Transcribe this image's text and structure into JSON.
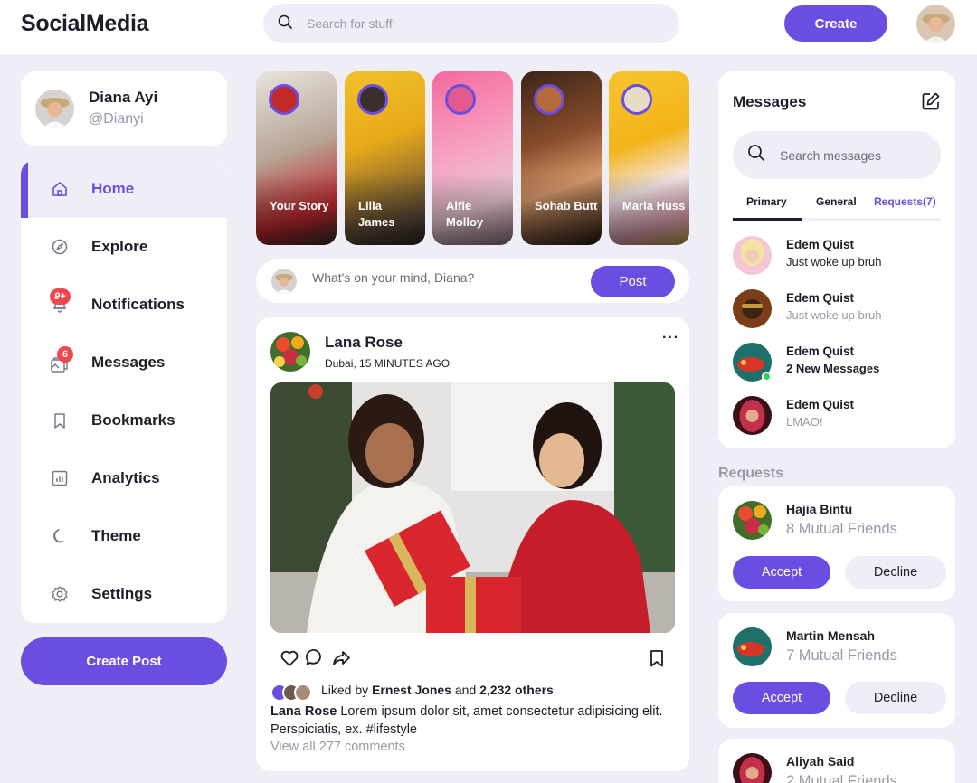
{
  "app": {
    "logo": "SocialMedia"
  },
  "header": {
    "search_placeholder": "Search for stuff!",
    "create_label": "Create"
  },
  "profile": {
    "name": "Diana Ayi",
    "handle": "@Dianyi"
  },
  "sidebar": {
    "items": [
      {
        "label": "Home",
        "icon": "home-icon",
        "active": true
      },
      {
        "label": "Explore",
        "icon": "compass-icon"
      },
      {
        "label": "Notifications",
        "icon": "bell-icon",
        "badge": "9+"
      },
      {
        "label": "Messages",
        "icon": "messages-icon",
        "badge": "6"
      },
      {
        "label": "Bookmarks",
        "icon": "bookmark-icon"
      },
      {
        "label": "Analytics",
        "icon": "chart-icon"
      },
      {
        "label": "Theme",
        "icon": "moon-icon"
      },
      {
        "label": "Settings",
        "icon": "gear-icon"
      }
    ],
    "create_post_label": "Create Post"
  },
  "stories": [
    {
      "name": "Your Story"
    },
    {
      "name": "Lilla James"
    },
    {
      "name": "Alfie Molloy"
    },
    {
      "name": "Sohab Butt"
    },
    {
      "name": "Maria Huss"
    }
  ],
  "compose": {
    "placeholder": "What's on your mind, Diana?",
    "post_label": "Post"
  },
  "feed": {
    "author": "Lana Rose",
    "location": "Dubai, 15 MINUTES AGO",
    "more": "···",
    "liked_prefix": "Liked by ",
    "liked_user": "Ernest Jones",
    "liked_and": " and ",
    "liked_others": "2,232 others",
    "caption_author": "Lana Rose",
    "caption_text": " Lorem ipsum dolor sit, amet consectetur adipisicing elit. Perspiciatis, ex. ",
    "hashtag": "#lifestyle",
    "view_comments": "View all 277 comments"
  },
  "messages": {
    "title": "Messages",
    "search_placeholder": "Search messages",
    "tabs": [
      "Primary",
      "General",
      "Requests(7)"
    ],
    "rows": [
      {
        "name": "Edem Quist",
        "text": "Just woke up bruh",
        "style": "normal"
      },
      {
        "name": "Edem Quist",
        "text": "Just woke up bruh",
        "style": "muted"
      },
      {
        "name": "Edem Quist",
        "text": "2 New Messages",
        "style": "bold"
      },
      {
        "name": "Edem Quist",
        "text": "LMAO!",
        "style": "muted"
      }
    ]
  },
  "requests": {
    "heading": "Requests",
    "accept_label": "Accept",
    "decline_label": "Decline",
    "items": [
      {
        "name": "Hajia Bintu",
        "mutual": "8 Mutual Friends"
      },
      {
        "name": "Martin Mensah",
        "mutual": "7 Mutual Friends"
      },
      {
        "name": "Aliyah Said",
        "mutual": "2 Mutual Friends"
      }
    ]
  },
  "colors": {
    "accent": "#6c4de2",
    "badge": "#f0474f",
    "page_bg": "#efeef7",
    "muted": "#9a98a8"
  }
}
